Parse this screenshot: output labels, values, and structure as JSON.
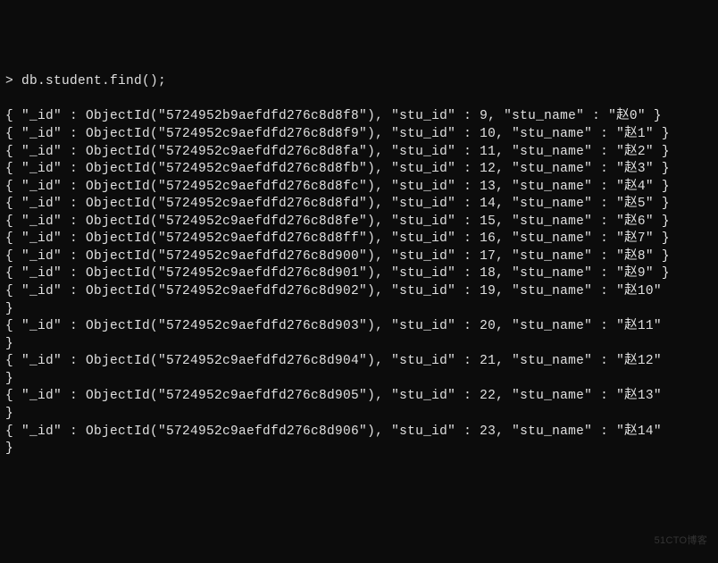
{
  "prompt": "> db.student.find();",
  "records": [
    {
      "oid": "5724952b9aefdfd276c8d8f8",
      "stu_id": 9,
      "stu_name": "赵0",
      "wrap": false
    },
    {
      "oid": "5724952c9aefdfd276c8d8f9",
      "stu_id": 10,
      "stu_name": "赵1",
      "wrap": true
    },
    {
      "oid": "5724952c9aefdfd276c8d8fa",
      "stu_id": 11,
      "stu_name": "赵2",
      "wrap": true
    },
    {
      "oid": "5724952c9aefdfd276c8d8fb",
      "stu_id": 12,
      "stu_name": "赵3",
      "wrap": true
    },
    {
      "oid": "5724952c9aefdfd276c8d8fc",
      "stu_id": 13,
      "stu_name": "赵4",
      "wrap": true
    },
    {
      "oid": "5724952c9aefdfd276c8d8fd",
      "stu_id": 14,
      "stu_name": "赵5",
      "wrap": true
    },
    {
      "oid": "5724952c9aefdfd276c8d8fe",
      "stu_id": 15,
      "stu_name": "赵6",
      "wrap": true
    },
    {
      "oid": "5724952c9aefdfd276c8d8ff",
      "stu_id": 16,
      "stu_name": "赵7",
      "wrap": true
    },
    {
      "oid": "5724952c9aefdfd276c8d900",
      "stu_id": 17,
      "stu_name": "赵8",
      "wrap": true
    },
    {
      "oid": "5724952c9aefdfd276c8d901",
      "stu_id": 18,
      "stu_name": "赵9",
      "wrap": true
    },
    {
      "oid": "5724952c9aefdfd276c8d902",
      "stu_id": 19,
      "stu_name": "赵10",
      "wrap": true
    },
    {
      "oid": "5724952c9aefdfd276c8d903",
      "stu_id": 20,
      "stu_name": "赵11",
      "wrap": true
    },
    {
      "oid": "5724952c9aefdfd276c8d904",
      "stu_id": 21,
      "stu_name": "赵12",
      "wrap": true
    },
    {
      "oid": "5724952c9aefdfd276c8d905",
      "stu_id": 22,
      "stu_name": "赵13",
      "wrap": true
    },
    {
      "oid": "5724952c9aefdfd276c8d906",
      "stu_id": 23,
      "stu_name": "赵14",
      "wrap": true
    }
  ],
  "watermark": "51CTO博客"
}
